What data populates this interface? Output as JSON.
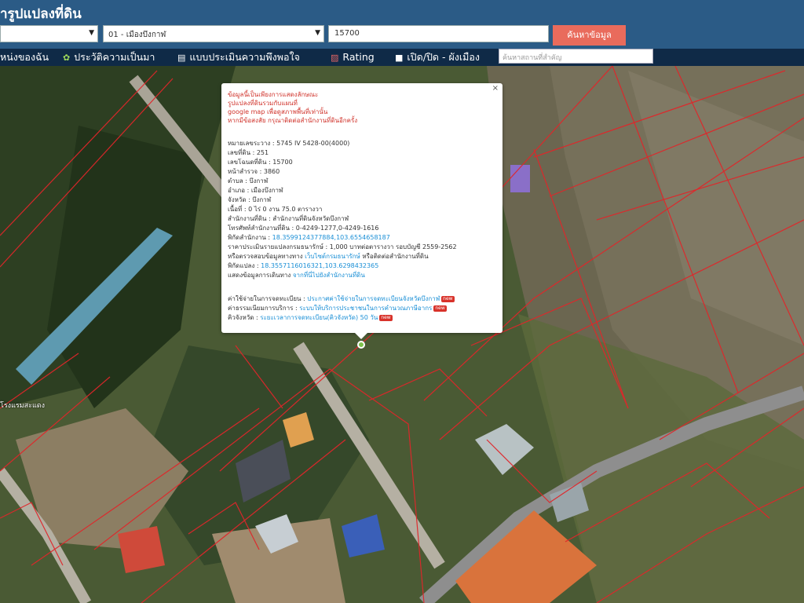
{
  "header": {
    "title": "ารูปแปลงที่ดิน",
    "province_select": "",
    "district_select": "01 - เมืองบึงกาฬ",
    "parcel_input": "15700",
    "search_button": "ค้นหาข้อมูล"
  },
  "toolbar": {
    "items": [
      {
        "label": "หน่งของฉัน",
        "icon": "location-icon"
      },
      {
        "label": "ประวัติความเป็นมา",
        "icon": "plant-icon"
      },
      {
        "label": "แบบประเมินความพึงพอใจ",
        "icon": "document-icon"
      },
      {
        "label": "Rating",
        "icon": "chart-icon"
      },
      {
        "label": "เปิด/ปิด - ผังเมือง",
        "icon": "square-icon"
      }
    ],
    "place_search_placeholder": "ค้นหาสถานที่สำคัญ"
  },
  "popup": {
    "disclaimer": [
      "ข้อมูลนี้เป็นเพียงการแสดงลักษณะ",
      "รูปแปลงที่ดินรวมกับแผนที่",
      "google map เพื่อดูสภาพพื้นที่เท่านั้น",
      "หากมีข้อสงสัย กรุณาติดต่อสำนักงานที่ดินอีกครั้ง"
    ],
    "details": [
      "หมายเลขระวาง : 5745 IV 5428-00(4000)",
      "เลขที่ดิน : 251",
      "เลขโฉนดที่ดิน : 15700",
      "หน้าสำรวจ : 3860",
      "ตำบล : บึงกาฬ",
      "อำเภอ : เมืองบึงกาฬ",
      "จังหวัด : บึงกาฬ",
      "เนื้อที่ : 0 ไร่ 0 งาน 75.0 ตารางวา",
      "สำนักงานที่ดิน : สำนักงานที่ดินจังหวัดบึงกาฬ",
      "โทรศัพท์สำนักงานที่ดิน : 0-4249-1277,0-4249-1616"
    ],
    "office_coord_label": "พิกัดสำนักงาน : ",
    "office_coord_value": "18.3599124377884,103.6554658187",
    "appraisal": "ราคาประเมินรายแปลงกรมธนารักษ์ : 1,000 บาทต่อตารางวา รอบบัญชี 2559-2562",
    "check_prefix": "หรือตรวจสอบข้อมูลทางทาง ",
    "check_link": "เว็บไซต์กรมธนารักษ์",
    "check_suffix": " หรือติดต่อสำนักงานที่ดิน",
    "parcel_coord_label": "พิกัดแปลง : ",
    "parcel_coord_value": "18.3557116016321,103.6298432365",
    "route_label": "แสดงข้อมูลการเดินทาง ",
    "route_link": "จากที่นี่ไปยังสำนักงานที่ดิน",
    "services": [
      {
        "label": "ค่าใช้จ่ายในการจดทะเบียน : ",
        "link": "ประกาศค่าใช้จ่ายในการจดทะเบียนจังหวัดบึงกาฬ"
      },
      {
        "label": "ค่าธรรมเนียมการบริการ : ",
        "link": "ระบบให้บริการประชาชนในการคำนวณภาษีอากร"
      },
      {
        "label": "คิวจังหวัด : ",
        "link": "ระยะเวลาการจดทะเบียน(คิวจังหวัด) 50 วัน"
      }
    ],
    "new_badge": "new"
  },
  "map": {
    "place_label": "โรงแรมสะแดง"
  },
  "colors": {
    "header": "#2b5b86",
    "toolbar": "#0f2a47",
    "search_button": "#e96b5c",
    "parcel_line": "#e0262a",
    "link": "#1a8fd6"
  }
}
